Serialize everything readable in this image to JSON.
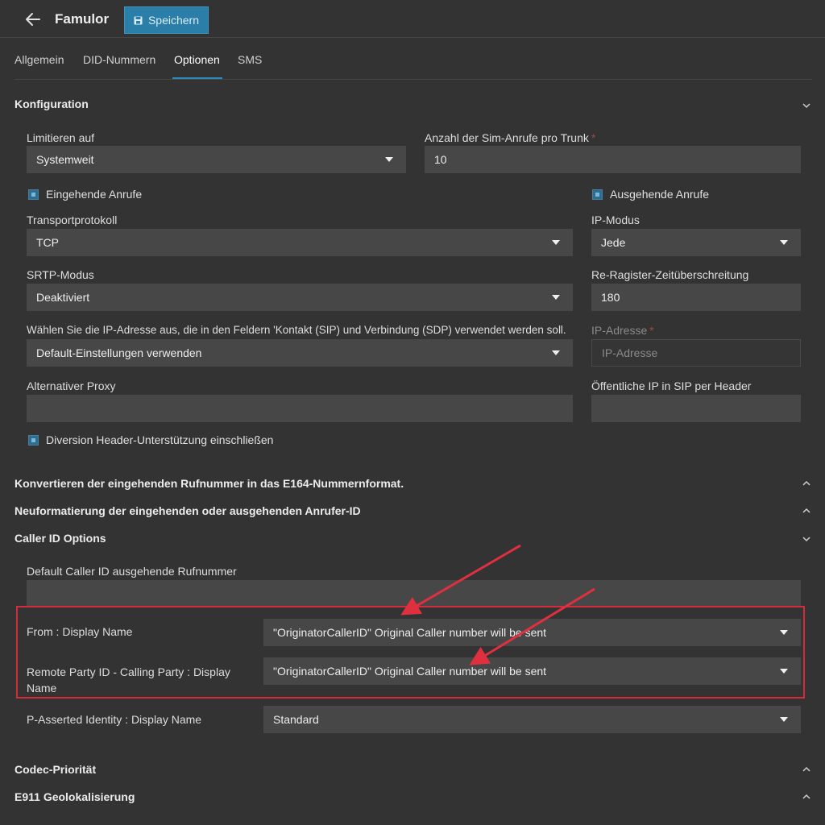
{
  "header": {
    "title": "Famulor",
    "save_label": "Speichern"
  },
  "tabs": [
    "Allgemein",
    "DID-Nummern",
    "Optionen",
    "SMS"
  ],
  "sections": {
    "konfiguration": {
      "title": "Konfiguration",
      "limit": {
        "label": "Limitieren auf",
        "value": "Systemweit"
      },
      "sim_calls": {
        "label": "Anzahl der Sim-Anrufe pro Trunk",
        "required_mark": "*",
        "value": "10"
      },
      "incoming_calls": {
        "label": "Eingehende Anrufe",
        "checked": true
      },
      "outgoing_calls": {
        "label": "Ausgehende Anrufe",
        "checked": true
      },
      "transport": {
        "label": "Transportprotokoll",
        "value": "TCP"
      },
      "ip_mode": {
        "label": "IP-Modus",
        "value": "Jede"
      },
      "srtp": {
        "label": "SRTP-Modus",
        "value": "Deaktiviert"
      },
      "reregister": {
        "label": "Re-Ragister-Zeitüberschreitung",
        "value": "180"
      },
      "ip_select": {
        "label": "Wählen Sie die IP-Adresse aus, die in den Feldern 'Kontakt (SIP) und Verbindung (SDP) verwendet werden soll.",
        "value": "Default-Einstellungen verwenden"
      },
      "ip_address": {
        "label": "IP-Adresse",
        "required_mark": "*",
        "placeholder": "IP-Adresse"
      },
      "alt_proxy": {
        "label": "Alternativer Proxy",
        "value": ""
      },
      "public_ip": {
        "label": "Öffentliche IP in SIP per Header",
        "value": ""
      },
      "diversion": {
        "label": "Diversion Header-Unterstützung einschließen",
        "checked": true
      }
    },
    "e164": {
      "title": "Konvertieren der eingehenden Rufnummer in das E164-Nummernformat."
    },
    "reformat": {
      "title": "Neuformatierung der eingehenden oder ausgehenden Anrufer-ID"
    },
    "caller_id": {
      "title": "Caller ID Options",
      "default_caller": {
        "label": "Default Caller ID ausgehende Rufnummer",
        "value": ""
      },
      "from_display": {
        "label": "From : Display Name",
        "value": "\"OriginatorCallerID\" Original Caller number will be sent"
      },
      "rpid_display": {
        "label": "Remote Party ID - Calling Party : Display Name",
        "value": "\"OriginatorCallerID\" Original Caller number will be sent"
      },
      "pai_display": {
        "label": "P-Asserted Identity : Display Name",
        "value": "Standard"
      }
    },
    "codec": {
      "title": "Codec-Priorität"
    },
    "e911": {
      "title": "E911 Geolokalisierung"
    }
  },
  "colors": {
    "background": "#333333",
    "field": "#474747",
    "accent": "#2b7ea8",
    "highlight": "#d42c3c"
  },
  "icons": [
    "back-arrow-icon",
    "save-icon",
    "chevron-down-icon",
    "chevron-up-icon",
    "caret-down-icon",
    "red-arrow-annotation"
  ]
}
